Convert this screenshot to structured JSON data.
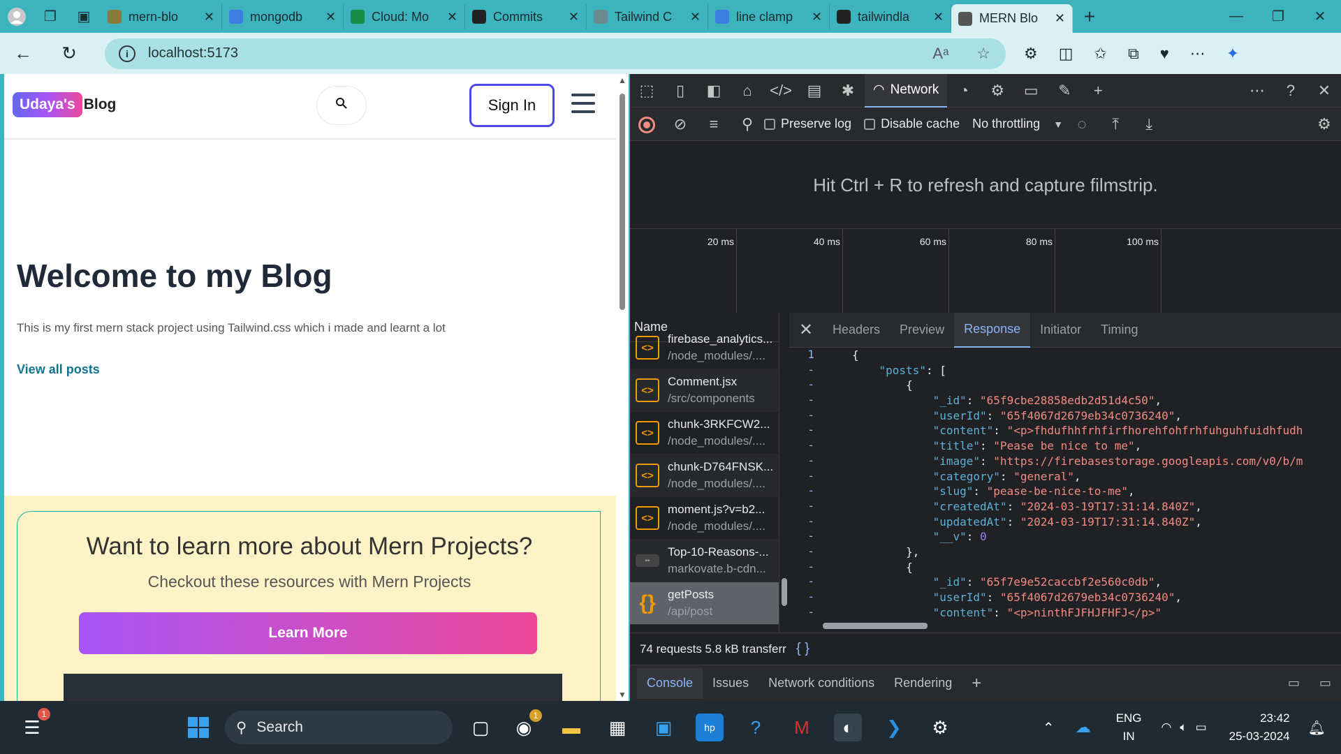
{
  "browser": {
    "tabs": [
      {
        "title": "mern-blo",
        "color": "#8b7a3a"
      },
      {
        "title": "mongodb",
        "color": "#3b7de0"
      },
      {
        "title": "Cloud: Mo",
        "color": "#1b8c48"
      },
      {
        "title": "Commits",
        "color": "#222"
      },
      {
        "title": "Tailwind C",
        "color": "#6b8a8f"
      },
      {
        "title": "line clamp",
        "color": "#3b7de0"
      },
      {
        "title": "tailwindla",
        "color": "#222"
      },
      {
        "title": "MERN Blo",
        "color": "#555"
      }
    ],
    "url": "localhost:5173"
  },
  "site": {
    "logo_pill": "Udaya's",
    "logo_rest": "Blog",
    "sign_in": "Sign In",
    "hero_title": "Welcome to my Blog",
    "hero_sub": "This is my first mern stack project using Tailwind.css which i made and learnt a lot",
    "view_all": "View all posts",
    "cta_title": "Want to learn more about Mern Projects?",
    "cta_sub": "Checkout these resources with Mern Projects",
    "cta_button": "Learn More"
  },
  "devtools": {
    "network_tab": "Network",
    "preserve_log": "Preserve log",
    "disable_cache": "Disable cache",
    "throttling": "No throttling",
    "filmstrip_hint": "Hit Ctrl + R to refresh and capture filmstrip.",
    "timeline_ticks": [
      "20 ms",
      "40 ms",
      "60 ms",
      "80 ms",
      "100 ms"
    ],
    "name_header": "Name",
    "requests": [
      {
        "name": "firebase_analytics...",
        "path": "/node_modules/....",
        "icon": "<>"
      },
      {
        "name": "Comment.jsx",
        "path": "/src/components",
        "icon": "<>"
      },
      {
        "name": "chunk-3RKFCW2...",
        "path": "/node_modules/....",
        "icon": "<>"
      },
      {
        "name": "chunk-D764FNSK...",
        "path": "/node_modules/....",
        "icon": "<>"
      },
      {
        "name": "moment.js?v=b2...",
        "path": "/node_modules/....",
        "icon": "<>"
      },
      {
        "name": "Top-10-Reasons-...",
        "path": "markovate.b-cdn...",
        "icon": "img"
      },
      {
        "name": "getPosts",
        "path": "/api/post",
        "icon": "{;}"
      }
    ],
    "resp_tabs": [
      "Headers",
      "Preview",
      "Response",
      "Initiator",
      "Timing"
    ],
    "active_resp_tab": "Response",
    "summary": "74 requests  5.8 kB transferr",
    "drawer_tabs": [
      "Console",
      "Issues",
      "Network conditions",
      "Rendering"
    ],
    "code_lines": [
      {
        "gutter": "1",
        "text": "{"
      },
      {
        "gutter": "-",
        "key": "\"posts\"",
        "rest": ": ["
      },
      {
        "gutter": "-",
        "text": "        {"
      },
      {
        "gutter": "-",
        "key": "\"_id\"",
        "val": "\"65f9cbe28858edb2d51d4c50\"",
        "tail": ","
      },
      {
        "gutter": "-",
        "key": "\"userId\"",
        "val": "\"65f4067d2679eb34c0736240\"",
        "tail": ","
      },
      {
        "gutter": "-",
        "key": "\"content\"",
        "val": "\"<p>fhdufhhfrhfirfhorehfohfrhfuhguhfuidhfudh",
        "tail": ""
      },
      {
        "gutter": "-",
        "key": "\"title\"",
        "val": "\"Pease be nice to me\"",
        "tail": ","
      },
      {
        "gutter": "-",
        "key": "\"image\"",
        "val": "\"https://firebasestorage.googleapis.com/v0/b/m",
        "tail": ""
      },
      {
        "gutter": "-",
        "key": "\"category\"",
        "val": "\"general\"",
        "tail": ","
      },
      {
        "gutter": "-",
        "key": "\"slug\"",
        "val": "\"pease-be-nice-to-me\"",
        "tail": ","
      },
      {
        "gutter": "-",
        "key": "\"createdAt\"",
        "val": "\"2024-03-19T17:31:14.840Z\"",
        "tail": ","
      },
      {
        "gutter": "-",
        "key": "\"updatedAt\"",
        "val": "\"2024-03-19T17:31:14.840Z\"",
        "tail": ","
      },
      {
        "gutter": "-",
        "key": "\"__v\"",
        "num": "0",
        "tail": ""
      },
      {
        "gutter": "-",
        "text": "        },"
      },
      {
        "gutter": "-",
        "text": "        {"
      },
      {
        "gutter": "-",
        "key": "\"_id\"",
        "val": "\"65f7e9e52caccbf2e560c0db\"",
        "tail": ","
      },
      {
        "gutter": "-",
        "key": "\"userId\"",
        "val": "\"65f4067d2679eb34c0736240\"",
        "tail": ","
      },
      {
        "gutter": "-",
        "key": "\"content\"",
        "val": "\"<p>ninthFJFHJFHFJ</p>\"",
        "tail": ""
      }
    ]
  },
  "taskbar": {
    "search": "Search",
    "lang1": "ENG",
    "lang2": "IN",
    "time": "23:42",
    "date": "25-03-2024",
    "badge_widgets": "1",
    "badge_teams": "1"
  }
}
